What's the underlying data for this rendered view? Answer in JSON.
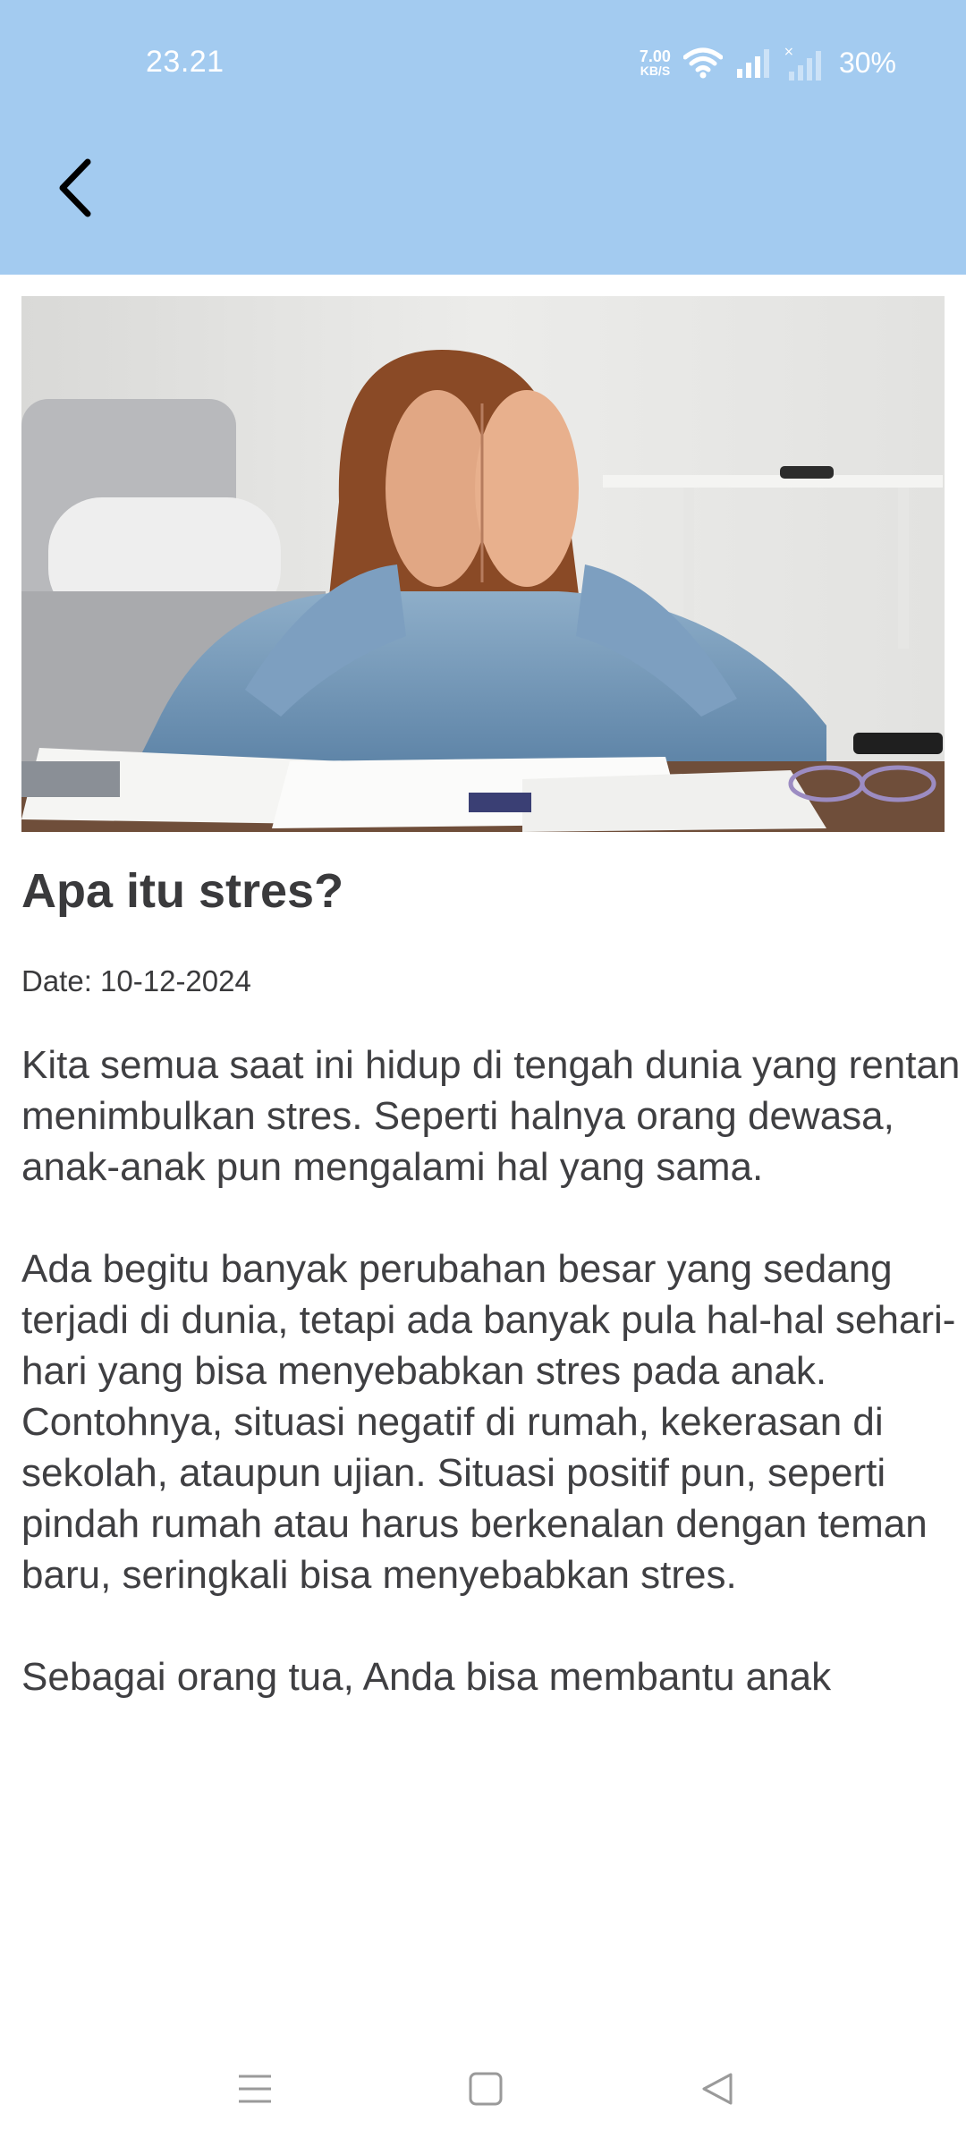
{
  "status_bar": {
    "time": "23.21",
    "net_speed_value": "7.00",
    "net_speed_unit": "KB/S",
    "battery": "30%",
    "icons": [
      "wifi-icon",
      "signal-icon",
      "signal-no-sim-icon"
    ]
  },
  "app_bar": {
    "back_icon": "chevron-left-icon",
    "background": "#a3cbf0"
  },
  "article": {
    "hero_image": "woman covering face with hands at desk",
    "title": "Apa itu stres?",
    "date": "Date: 10-12-2024",
    "paragraphs": [
      "Kita semua saat ini hidup di tengah dunia yang rentan menimbulkan stres. Seperti halnya orang dewasa, anak-anak pun mengalami hal yang sama.",
      "Ada begitu banyak perubahan besar yang sedang terjadi di dunia, tetapi ada banyak pula hal-hal sehari-hari yang bisa menyebabkan stres pada anak. Contohnya, situasi negatif di rumah, kekerasan di sekolah, ataupun ujian. Situasi positif pun, seperti pindah rumah atau harus berkenalan dengan teman baru, seringkali bisa menyebabkan stres.",
      "Sebagai orang tua, Anda bisa membantu anak"
    ]
  },
  "nav_bar": {
    "icons": [
      "menu-icon",
      "home-icon",
      "back-triangle-icon"
    ]
  }
}
